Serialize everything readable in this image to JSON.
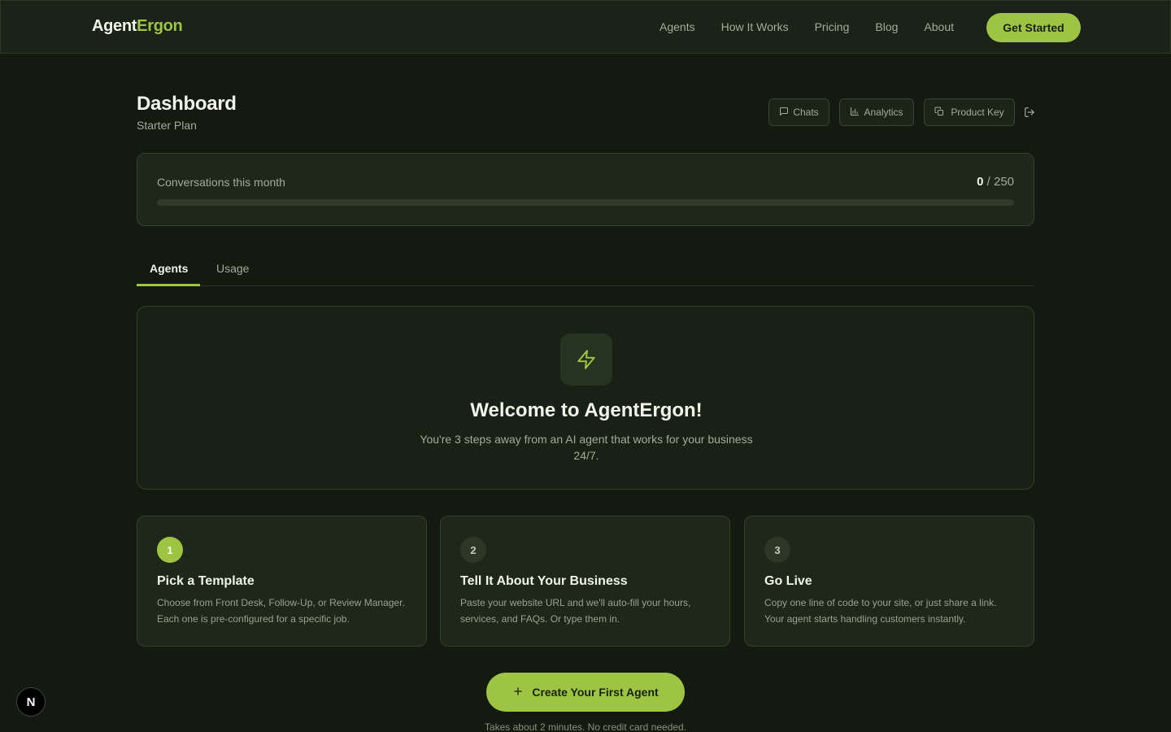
{
  "nav": {
    "brand_part1": "Agent",
    "brand_part2": "Ergon",
    "links": [
      "Agents",
      "How It Works",
      "Pricing",
      "Blog",
      "About"
    ],
    "cta_label": "Get Started"
  },
  "header": {
    "title": "Dashboard",
    "plan": "Starter Plan",
    "buttons": {
      "chats": "Chats",
      "analytics": "Analytics",
      "product_key": "Product Key"
    },
    "icons": {
      "chats": "chat-bubble-icon",
      "analytics": "bar-chart-icon",
      "product_key": "copy-icon",
      "logout": "logout-icon"
    }
  },
  "usage": {
    "label": "Conversations this month",
    "used": "0",
    "limit_text": " / 250",
    "progress_fraction": 0
  },
  "tabs": [
    {
      "label": "Agents",
      "active": true
    },
    {
      "label": "Usage",
      "active": false
    }
  ],
  "welcome": {
    "icon": "lightning-bolt-icon",
    "title": "Welcome to AgentErgon!",
    "text": "You're 3 steps away from an AI agent that works for your business 24/7."
  },
  "steps": [
    {
      "number": "1",
      "title": "Pick a Template",
      "text": "Choose from Front Desk, Follow-Up, or Review Manager. Each one is pre-configured for a specific job."
    },
    {
      "number": "2",
      "title": "Tell It About Your Business",
      "text": "Paste your website URL and we'll auto-fill your hours, services, and FAQs. Or type them in."
    },
    {
      "number": "3",
      "title": "Go Live",
      "text": "Copy one line of code to your site, or just share a link. Your agent starts handling customers instantly."
    }
  ],
  "cta": {
    "label": "Create Your First Agent",
    "note": "Takes about 2 minutes. No credit card needed."
  },
  "dev_badge": "N",
  "colors": {
    "accent": "#9ec443",
    "background": "#141a10",
    "card": "#1e2719"
  }
}
